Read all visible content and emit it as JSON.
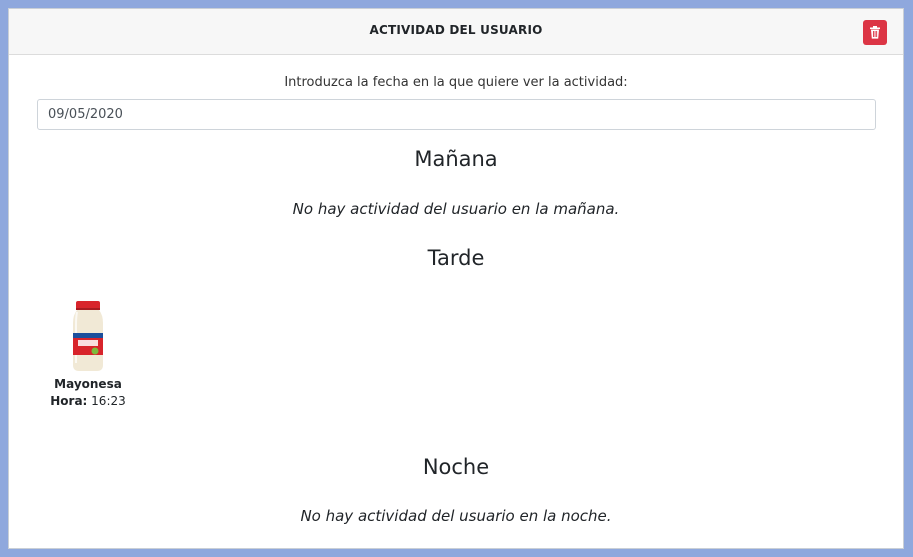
{
  "header": {
    "title": "ACTIVIDAD DEL USUARIO",
    "delete_icon": "trash-icon",
    "delete_color": "#dc3545"
  },
  "date_prompt": "Introduzca la fecha en la que quiere ver la actividad:",
  "date_value": "09/05/2020",
  "sections": {
    "morning": {
      "title": "Mañana",
      "empty_message": "No hay actividad del usuario en la mañana."
    },
    "afternoon": {
      "title": "Tarde",
      "items": [
        {
          "name": "Mayonesa",
          "time_label": "Hora:",
          "time": "16:23"
        }
      ]
    },
    "night": {
      "title": "Noche",
      "empty_message": "No hay actividad del usuario en la noche."
    }
  }
}
